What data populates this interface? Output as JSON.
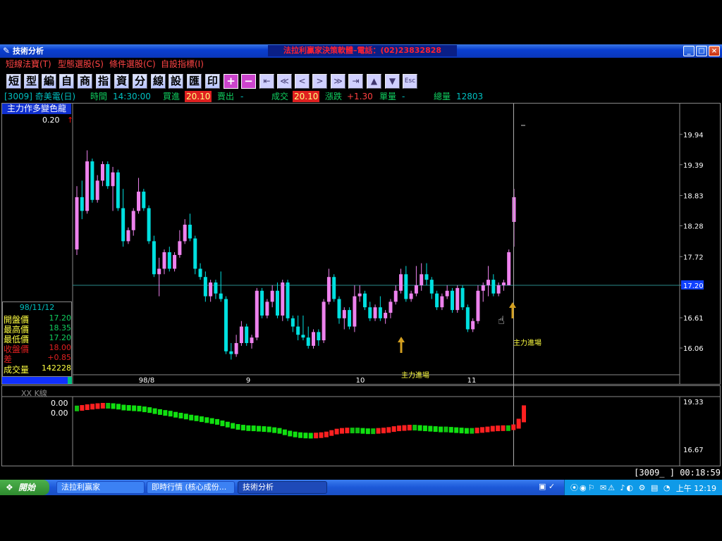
{
  "window": {
    "app_icon": "chart-app-icon",
    "title": "技術分析",
    "banner": "法拉利贏家決策軟體–電話：(02)23832828",
    "min_label": "_",
    "max_label": "□",
    "close_label": "×"
  },
  "menu": [
    "短線法寶(T)",
    "型態選股(S)",
    "條件選股(C)",
    "自設指標(I)"
  ],
  "toolbar": {
    "chars": [
      "短",
      "型",
      "編",
      "自",
      "商",
      "指",
      "資",
      "分",
      "線",
      "設",
      "匯",
      "印"
    ],
    "plus": "+",
    "minus": "−",
    "nav": [
      "⇤",
      "≪",
      "<",
      ">",
      "≫",
      "⇥",
      "▲",
      "▼",
      "Esc"
    ]
  },
  "quote": {
    "symbol": "[3009] 奇美電(日)",
    "time_label": "時間",
    "time": "14:30:00",
    "bid_label": "買進",
    "bid": "20.10",
    "ask_label": "賣出",
    "ask": "-",
    "last_label": "成交",
    "last": "20.10",
    "change_label": "漲跌",
    "change": "+1.30",
    "vol_label": "單量",
    "vol": "-",
    "total_label": "總量",
    "total": "12803"
  },
  "indicator": {
    "title": "主力作多變色龍",
    "value": "0.20",
    "mark": "↑"
  },
  "ohlc": {
    "date": "98/11/12",
    "rows": [
      {
        "label": "開盤價",
        "value": "17.20",
        "color": "y"
      },
      {
        "label": "最高價",
        "value": "18.35",
        "color": "y"
      },
      {
        "label": "最低價",
        "value": "17.20",
        "color": "y"
      },
      {
        "label": "收盤價",
        "value": "18.00",
        "color": "r"
      },
      {
        "label": "差",
        "value": "+0.85",
        "color": "r"
      },
      {
        "label": "成交量",
        "value": "142228",
        "color": "y"
      }
    ]
  },
  "chart_data": [
    {
      "type": "candlestick",
      "title": "主力作多變色龍",
      "x_labels": [
        "98/8",
        "9",
        "10",
        "11"
      ],
      "y_ticks": [
        "19.94",
        "19.39",
        "18.83",
        "18.28",
        "17.72",
        "17.20",
        "16.61",
        "16.06"
      ],
      "ylim": [
        15.6,
        20.5
      ],
      "reference_line": 17.2,
      "reference_label": "17.20",
      "annotations": [
        "主力進場",
        "主力進場"
      ],
      "colors": {
        "up": "#ee82ee",
        "down": "#00e0e0",
        "ref": "#2a8a8a"
      },
      "candles": [
        {
          "o": 17.85,
          "h": 19.0,
          "l": 17.75,
          "c": 18.8
        },
        {
          "o": 18.8,
          "h": 19.1,
          "l": 18.4,
          "c": 18.55
        },
        {
          "o": 18.55,
          "h": 19.65,
          "l": 18.5,
          "c": 19.45
        },
        {
          "o": 19.45,
          "h": 19.5,
          "l": 18.7,
          "c": 18.75
        },
        {
          "o": 18.75,
          "h": 19.2,
          "l": 18.7,
          "c": 19.1
        },
        {
          "o": 19.1,
          "h": 19.45,
          "l": 19.0,
          "c": 19.4
        },
        {
          "o": 19.4,
          "h": 19.45,
          "l": 18.95,
          "c": 19.0
        },
        {
          "o": 19.0,
          "h": 19.35,
          "l": 18.55,
          "c": 19.25
        },
        {
          "o": 19.25,
          "h": 19.3,
          "l": 18.55,
          "c": 18.6
        },
        {
          "o": 18.6,
          "h": 18.95,
          "l": 17.9,
          "c": 18.0
        },
        {
          "o": 18.0,
          "h": 18.25,
          "l": 17.95,
          "c": 18.2
        },
        {
          "o": 18.2,
          "h": 18.6,
          "l": 18.1,
          "c": 18.55
        },
        {
          "o": 18.55,
          "h": 19.15,
          "l": 18.5,
          "c": 18.9
        },
        {
          "o": 18.9,
          "h": 18.95,
          "l": 18.55,
          "c": 18.6
        },
        {
          "o": 18.6,
          "h": 18.65,
          "l": 17.95,
          "c": 18.0
        },
        {
          "o": 18.0,
          "h": 18.1,
          "l": 17.35,
          "c": 17.4
        },
        {
          "o": 17.4,
          "h": 17.7,
          "l": 17.0,
          "c": 17.5
        },
        {
          "o": 17.5,
          "h": 17.85,
          "l": 17.4,
          "c": 17.8
        },
        {
          "o": 17.8,
          "h": 17.9,
          "l": 17.45,
          "c": 17.5
        },
        {
          "o": 17.5,
          "h": 17.8,
          "l": 17.45,
          "c": 17.75
        },
        {
          "o": 17.75,
          "h": 18.2,
          "l": 17.7,
          "c": 18.0
        },
        {
          "o": 18.0,
          "h": 18.4,
          "l": 17.95,
          "c": 18.3
        },
        {
          "o": 18.3,
          "h": 18.5,
          "l": 18.0,
          "c": 18.05
        },
        {
          "o": 18.05,
          "h": 18.1,
          "l": 17.4,
          "c": 17.5
        },
        {
          "o": 17.5,
          "h": 17.6,
          "l": 17.3,
          "c": 17.35
        },
        {
          "o": 17.35,
          "h": 17.45,
          "l": 16.9,
          "c": 17.0
        },
        {
          "o": 17.0,
          "h": 17.3,
          "l": 16.9,
          "c": 17.25
        },
        {
          "o": 17.25,
          "h": 17.3,
          "l": 16.95,
          "c": 17.05
        },
        {
          "o": 17.05,
          "h": 17.45,
          "l": 16.9,
          "c": 16.95
        },
        {
          "o": 16.95,
          "h": 17.0,
          "l": 15.95,
          "c": 16.0
        },
        {
          "o": 16.0,
          "h": 16.15,
          "l": 15.85,
          "c": 15.95
        },
        {
          "o": 15.95,
          "h": 16.3,
          "l": 15.9,
          "c": 16.15
        },
        {
          "o": 16.15,
          "h": 16.55,
          "l": 16.1,
          "c": 16.45
        },
        {
          "o": 16.45,
          "h": 16.5,
          "l": 16.1,
          "c": 16.15
        },
        {
          "o": 16.15,
          "h": 16.3,
          "l": 16.05,
          "c": 16.25
        },
        {
          "o": 16.25,
          "h": 17.15,
          "l": 16.2,
          "c": 17.1
        },
        {
          "o": 17.1,
          "h": 17.15,
          "l": 16.6,
          "c": 16.65
        },
        {
          "o": 16.65,
          "h": 16.95,
          "l": 16.6,
          "c": 16.9
        },
        {
          "o": 16.9,
          "h": 17.2,
          "l": 16.8,
          "c": 17.1
        },
        {
          "o": 17.1,
          "h": 17.25,
          "l": 16.6,
          "c": 16.65
        },
        {
          "o": 16.65,
          "h": 17.3,
          "l": 16.55,
          "c": 17.25
        },
        {
          "o": 17.25,
          "h": 17.3,
          "l": 16.55,
          "c": 16.6
        },
        {
          "o": 16.6,
          "h": 16.65,
          "l": 16.35,
          "c": 16.45
        },
        {
          "o": 16.45,
          "h": 16.65,
          "l": 16.2,
          "c": 16.3
        },
        {
          "o": 16.3,
          "h": 16.65,
          "l": 16.2,
          "c": 16.25
        },
        {
          "o": 16.25,
          "h": 16.45,
          "l": 16.05,
          "c": 16.1
        },
        {
          "o": 16.1,
          "h": 16.4,
          "l": 16.05,
          "c": 16.35
        },
        {
          "o": 16.35,
          "h": 16.4,
          "l": 16.1,
          "c": 16.2
        },
        {
          "o": 16.2,
          "h": 16.95,
          "l": 16.15,
          "c": 16.9
        },
        {
          "o": 16.9,
          "h": 17.5,
          "l": 16.85,
          "c": 17.35
        },
        {
          "o": 17.35,
          "h": 17.4,
          "l": 16.9,
          "c": 16.95
        },
        {
          "o": 16.95,
          "h": 17.0,
          "l": 16.5,
          "c": 16.6
        },
        {
          "o": 16.6,
          "h": 16.8,
          "l": 16.4,
          "c": 16.75
        },
        {
          "o": 16.75,
          "h": 16.8,
          "l": 16.4,
          "c": 16.45
        },
        {
          "o": 16.45,
          "h": 17.2,
          "l": 16.35,
          "c": 17.0
        },
        {
          "o": 17.0,
          "h": 17.2,
          "l": 16.9,
          "c": 17.05
        },
        {
          "o": 17.05,
          "h": 17.1,
          "l": 16.75,
          "c": 16.8
        },
        {
          "o": 16.8,
          "h": 16.9,
          "l": 16.55,
          "c": 16.6
        },
        {
          "o": 16.6,
          "h": 16.85,
          "l": 16.55,
          "c": 16.8
        },
        {
          "o": 16.8,
          "h": 17.0,
          "l": 16.55,
          "c": 16.6
        },
        {
          "o": 16.6,
          "h": 16.75,
          "l": 16.5,
          "c": 16.7
        },
        {
          "o": 16.7,
          "h": 16.95,
          "l": 16.6,
          "c": 16.9
        },
        {
          "o": 16.9,
          "h": 17.2,
          "l": 16.85,
          "c": 17.1
        },
        {
          "o": 17.1,
          "h": 17.5,
          "l": 17.05,
          "c": 17.4
        },
        {
          "o": 17.4,
          "h": 17.55,
          "l": 16.9,
          "c": 16.95
        },
        {
          "o": 16.95,
          "h": 17.1,
          "l": 16.9,
          "c": 17.05
        },
        {
          "o": 17.05,
          "h": 17.55,
          "l": 17.0,
          "c": 17.2
        },
        {
          "o": 17.2,
          "h": 17.6,
          "l": 17.1,
          "c": 17.4
        },
        {
          "o": 17.4,
          "h": 17.6,
          "l": 17.2,
          "c": 17.3
        },
        {
          "o": 17.3,
          "h": 17.35,
          "l": 16.95,
          "c": 17.05
        },
        {
          "o": 17.05,
          "h": 17.1,
          "l": 16.75,
          "c": 16.8
        },
        {
          "o": 16.8,
          "h": 17.05,
          "l": 16.75,
          "c": 17.0
        },
        {
          "o": 17.0,
          "h": 17.2,
          "l": 16.95,
          "c": 17.1
        },
        {
          "o": 17.1,
          "h": 17.15,
          "l": 16.7,
          "c": 16.75
        },
        {
          "o": 16.75,
          "h": 17.2,
          "l": 16.7,
          "c": 17.15
        },
        {
          "o": 17.15,
          "h": 17.2,
          "l": 16.75,
          "c": 16.8
        },
        {
          "o": 16.8,
          "h": 16.85,
          "l": 16.35,
          "c": 16.4
        },
        {
          "o": 16.4,
          "h": 16.6,
          "l": 16.35,
          "c": 16.55
        },
        {
          "o": 16.55,
          "h": 17.2,
          "l": 16.5,
          "c": 17.1
        },
        {
          "o": 17.1,
          "h": 17.25,
          "l": 16.9,
          "c": 17.2
        },
        {
          "o": 17.2,
          "h": 17.55,
          "l": 17.0,
          "c": 17.3
        },
        {
          "o": 17.3,
          "h": 17.4,
          "l": 17.0,
          "c": 17.05
        },
        {
          "o": 17.05,
          "h": 17.25,
          "l": 17.0,
          "c": 17.2
        },
        {
          "o": 17.2,
          "h": 17.3,
          "l": 17.1,
          "c": 17.25
        },
        {
          "o": 17.2,
          "h": 17.85,
          "l": 17.2,
          "c": 17.8
        },
        {
          "o": 18.35,
          "h": 18.95,
          "l": 17.9,
          "c": 18.8
        }
      ]
    },
    {
      "type": "bar",
      "title": "XX K線",
      "values_label": [
        "0.00",
        "0.00"
      ],
      "y_ticks": [
        "19.33",
        "16.67"
      ],
      "ylim": [
        15.8,
        20.2
      ],
      "colors": {
        "up": "#ff2020",
        "down": "#10e010",
        "flat": "#10c010"
      },
      "values": [
        18.95,
        18.98,
        19.02,
        19.05,
        19.08,
        19.1,
        19.1,
        19.08,
        19.05,
        19.0,
        18.98,
        18.96,
        18.94,
        18.9,
        18.86,
        18.8,
        18.75,
        18.7,
        18.66,
        18.6,
        18.55,
        18.5,
        18.44,
        18.4,
        18.35,
        18.3,
        18.25,
        18.2,
        18.12,
        18.05,
        17.98,
        17.92,
        17.88,
        17.85,
        17.84,
        17.82,
        17.8,
        17.78,
        17.74,
        17.7,
        17.62,
        17.55,
        17.5,
        17.46,
        17.44,
        17.43,
        17.44,
        17.46,
        17.5,
        17.58,
        17.66,
        17.7,
        17.72,
        17.72,
        17.72,
        17.7,
        17.68,
        17.68,
        17.7,
        17.72,
        17.75,
        17.8,
        17.84,
        17.86,
        17.88,
        17.88,
        17.86,
        17.84,
        17.82,
        17.8,
        17.78,
        17.78,
        17.76,
        17.74,
        17.72,
        17.7,
        17.7,
        17.72,
        17.75,
        17.78,
        17.82,
        17.84,
        17.85,
        17.85,
        17.9,
        18.1,
        18.65
      ]
    }
  ],
  "subchart": {
    "title": "XX K線",
    "v1": "0.00",
    "v2": "0.00"
  },
  "status": "[3009_ ]  00:18:59",
  "taskbar": {
    "start": "開始",
    "tasks": [
      "法拉利贏家",
      "即時行情 (核心成份...",
      "技術分析"
    ],
    "tray_icons": "▣ ✓",
    "tray_group": "⦿◉⚐ ✉⚠ ♪◐ ⚙ ▤ ◔",
    "clock": "上午 12:19"
  }
}
